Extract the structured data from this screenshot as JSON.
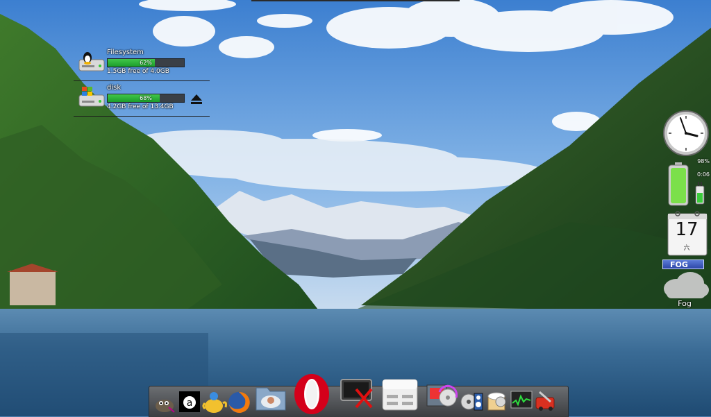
{
  "desktop": {
    "wallpaper": "lake-mountain-landscape"
  },
  "drives": [
    {
      "name": "Filesystem",
      "percent_label": "62%",
      "used_fraction": 0.62,
      "free_text": "1.5GB free of 4.0GB",
      "icon": "linux-drive-icon"
    },
    {
      "name": "disk",
      "percent_label": "68%",
      "used_fraction": 0.68,
      "free_text": "4.2GB free of 13.4GB",
      "icon": "windows-drive-icon",
      "eject_icon": "eject-icon"
    }
  ],
  "widgets": {
    "battery": {
      "percent_label": "98%",
      "time_label": "0:06",
      "level": 0.98
    },
    "calendar": {
      "day": "17",
      "weekday": "六"
    },
    "weather": {
      "badge": "FOG",
      "condition": "Fog"
    }
  },
  "dock": {
    "items": [
      {
        "name": "gimp",
        "icon": "gimp-icon"
      },
      {
        "name": "abiword",
        "icon": "abiword-icon"
      },
      {
        "name": "teapot",
        "icon": "teapot-icon"
      },
      {
        "name": "firefox",
        "icon": "firefox-icon"
      },
      {
        "name": "file-manager",
        "icon": "folder-icon"
      },
      {
        "name": "opera",
        "icon": "opera-icon"
      },
      {
        "name": "terminal",
        "icon": "terminal-icon"
      },
      {
        "name": "drive",
        "icon": "drive-icon"
      },
      {
        "name": "installer",
        "icon": "installer-icon"
      },
      {
        "name": "media",
        "icon": "media-icon"
      },
      {
        "name": "archive",
        "icon": "archive-icon"
      },
      {
        "name": "system-monitor",
        "icon": "system-monitor-icon"
      },
      {
        "name": "repair",
        "icon": "repair-icon"
      }
    ]
  },
  "colors": {
    "bar_fill": "#2bb33a",
    "weather_badge": "#3b57c2",
    "battery": "#7be04a"
  }
}
